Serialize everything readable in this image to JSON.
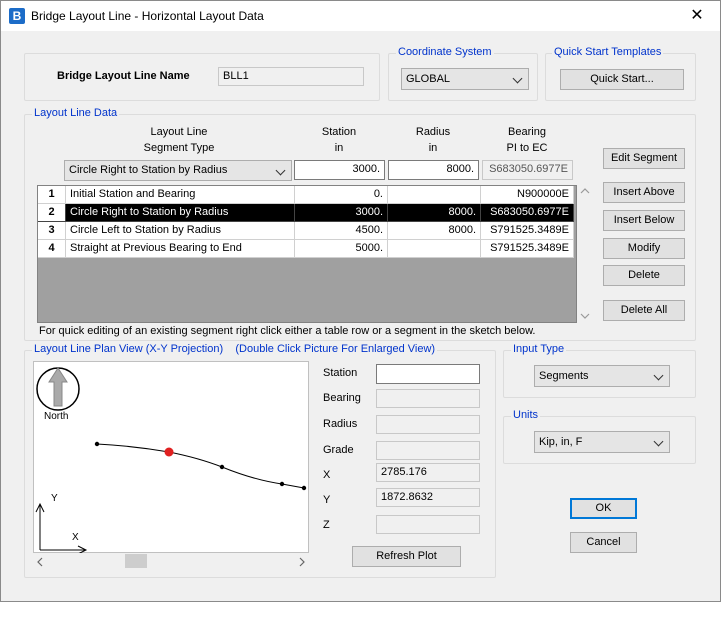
{
  "window": {
    "title": "Bridge Layout Line - Horizontal Layout Data",
    "close_glyph": "✕",
    "app_icon_letter": "B"
  },
  "name_group": {
    "label": "Bridge Layout Line Name",
    "value": "BLL1"
  },
  "coordinate_system": {
    "group_label": "Coordinate System",
    "selected": "GLOBAL"
  },
  "quick_start": {
    "group_label": "Quick Start Templates",
    "button_label": "Quick Start..."
  },
  "layout_line_data": {
    "group_label": "Layout Line Data",
    "headers": {
      "segment_type": [
        "Layout Line",
        "Segment Type"
      ],
      "station": [
        "Station",
        "in"
      ],
      "radius": [
        "Radius",
        "in"
      ],
      "bearing": [
        "Bearing",
        "PI to EC"
      ]
    },
    "edit_row": {
      "segment_type": "Circle Right to Station by Radius",
      "station": "3000.",
      "radius": "8000.",
      "bearing": "S683050.6977E"
    },
    "rows": [
      {
        "num": "1",
        "type": "Initial Station and Bearing",
        "station": "0.",
        "radius": "",
        "bearing": "N900000E"
      },
      {
        "num": "2",
        "type": "Circle Right to Station by Radius",
        "station": "3000.",
        "radius": "8000.",
        "bearing": "S683050.6977E"
      },
      {
        "num": "3",
        "type": "Circle Left to Station by Radius",
        "station": "4500.",
        "radius": "8000.",
        "bearing": "S791525.3489E"
      },
      {
        "num": "4",
        "type": "Straight at Previous Bearing to End",
        "station": "5000.",
        "radius": "",
        "bearing": "S791525.3489E"
      }
    ],
    "selected_row_index": 1,
    "buttons": {
      "edit_segment": "Edit Segment",
      "insert_above": "Insert Above",
      "insert_below": "Insert Below",
      "modify": "Modify",
      "delete": "Delete",
      "delete_all": "Delete All"
    },
    "hint": "For quick editing of an existing segment right click either a table row or a segment in the sketch below."
  },
  "plan_view": {
    "group_label": "Layout Line Plan View (X-Y Projection)",
    "group_label_note": "(Double Click Picture For Enlarged View)",
    "north_label": "North",
    "axis_y": "Y",
    "axis_x": "X",
    "fields": {
      "station": {
        "label": "Station",
        "value": ""
      },
      "bearing": {
        "label": "Bearing",
        "value": ""
      },
      "radius": {
        "label": "Radius",
        "value": ""
      },
      "grade": {
        "label": "Grade",
        "value": ""
      },
      "x": {
        "label": "X",
        "value": "2785.176"
      },
      "y": {
        "label": "Y",
        "value": "1872.8632"
      },
      "z": {
        "label": "Z",
        "value": ""
      }
    },
    "refresh_button": "Refresh Plot"
  },
  "input_type": {
    "group_label": "Input Type",
    "selected": "Segments"
  },
  "units": {
    "group_label": "Units",
    "selected": "Kip, in, F"
  },
  "ok_button": "OK",
  "cancel_button": "Cancel",
  "colors": {
    "group_label": "#0033cc",
    "selection": "#000000",
    "marker": "#e02020",
    "default_button_border": "#0078d7"
  }
}
